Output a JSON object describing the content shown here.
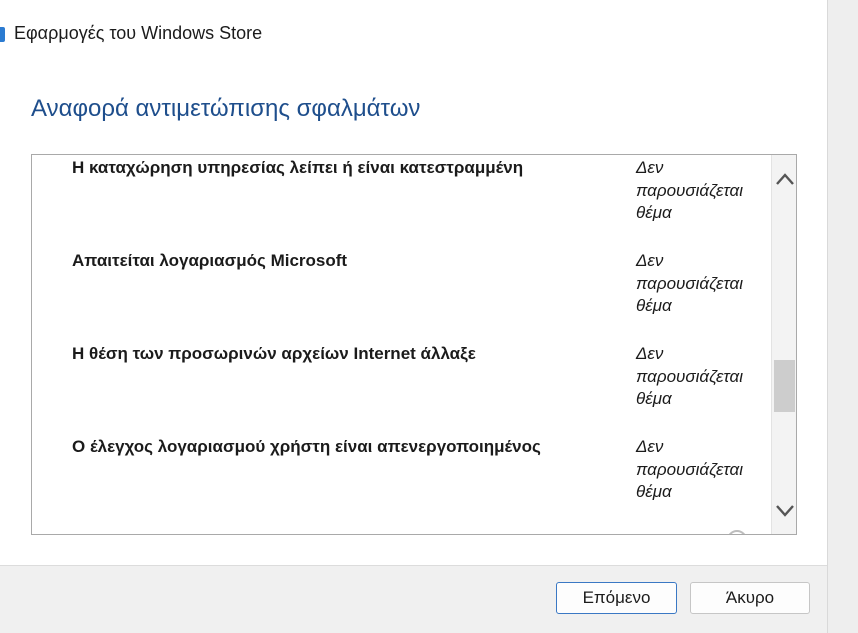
{
  "window": {
    "title": "Εφαρμογές του Windows Store",
    "accent_color": "#2b7bd1"
  },
  "heading": "Αναφορά αντιμετώπισης σφαλμάτων",
  "issues": [
    {
      "name": "Η καταχώρηση υπηρεσίας λείπει ή είναι κατεστραμμένη",
      "status": [
        "Δεν",
        "παρουσιάζεται",
        "θέμα"
      ]
    },
    {
      "name": "Απαιτείται λογαριασμός Microsoft",
      "status": [
        "Δεν",
        "παρουσιάζεται",
        "θέμα"
      ]
    },
    {
      "name": "Η θέση των προσωρινών αρχείων Internet άλλαξε",
      "status": [
        "Δεν",
        "παρουσιάζεται",
        "θέμα"
      ]
    },
    {
      "name": "Ο έλεγχος λογαριασμού χρήστη είναι απενεργοποιημένος",
      "status": [
        "Δεν",
        "παρουσιάζεται",
        "θέμα"
      ]
    }
  ],
  "scrollbar": {
    "up_icon": "chevron-up-icon",
    "down_icon": "chevron-down-icon"
  },
  "buttons": {
    "next": "Επόμενο",
    "cancel": "Άκυρο"
  }
}
